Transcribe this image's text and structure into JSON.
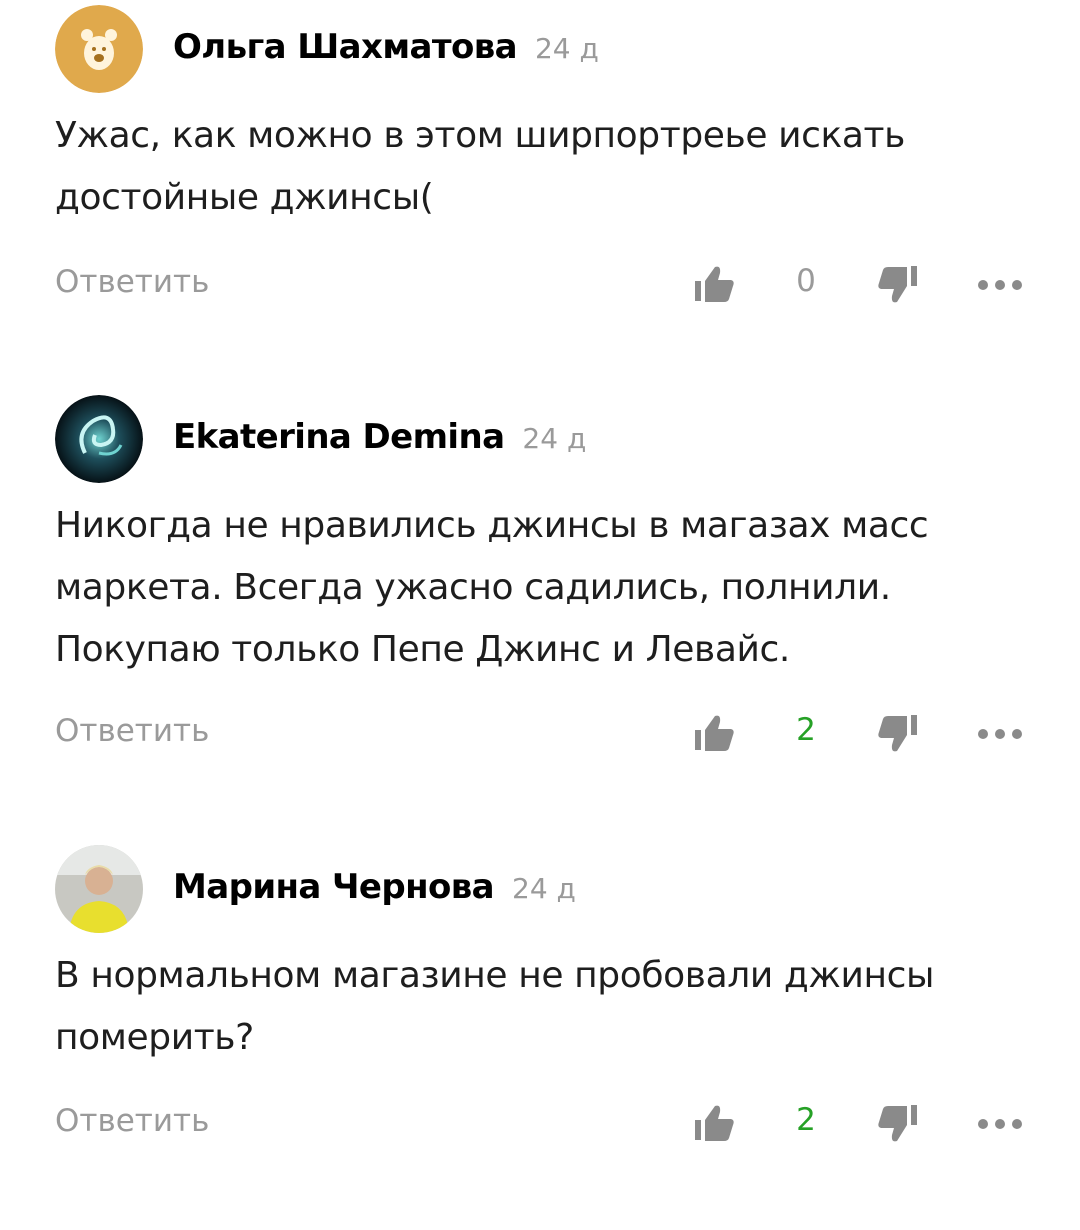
{
  "comments": [
    {
      "author": "Ольга Шахматова",
      "time": "24 д",
      "text_lines": [
        "Ужас, как можно в этом ширпортреье искать",
        "достойные джинсы("
      ],
      "reply_label": "Ответить",
      "likes": "0",
      "avatar_icon": "bear-avatar-icon"
    },
    {
      "author": "Ekaterina Demina",
      "time": "24 д",
      "text_lines": [
        "Никогда не нравились джинсы в магазах масс",
        "маркета. Всегда ужасно садились, полнили.",
        "Покупаю только Пепе Джинс и Левайс."
      ],
      "reply_label": "Ответить",
      "likes": "2",
      "avatar_icon": "swirl-avatar-icon"
    },
    {
      "author": "Марина Чернова",
      "time": "24 д",
      "text_lines": [
        "В нормальном магазине не пробовали джинсы",
        "померить?"
      ],
      "reply_label": "Ответить",
      "likes": "2",
      "avatar_icon": "photo-avatar-icon"
    }
  ],
  "colors": {
    "muted": "#9a9a9a",
    "like_positive": "#26a126",
    "icon": "#8a8a8a",
    "bear_avatar": "#e0a94c"
  }
}
